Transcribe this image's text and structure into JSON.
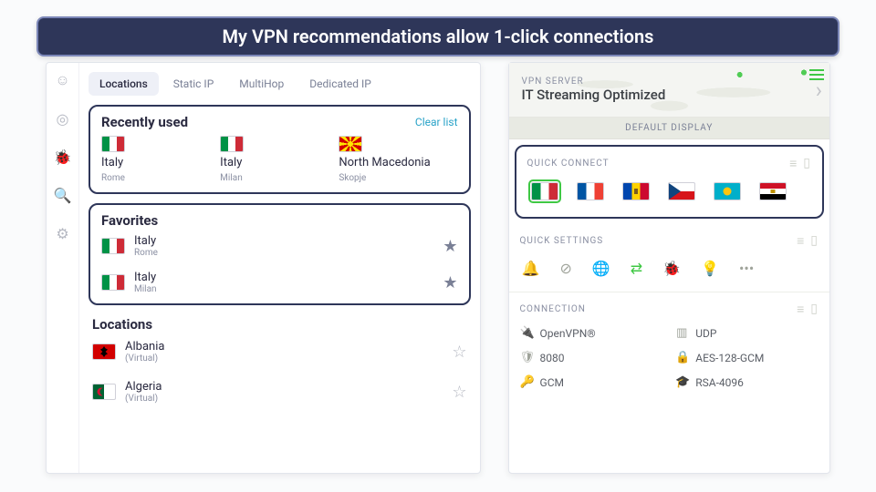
{
  "banner": {
    "text": "My VPN recommendations allow 1-click connections"
  },
  "left": {
    "rail_icons": [
      "user-icon",
      "radar-icon",
      "bug-icon",
      "search-icon",
      "gear-icon"
    ],
    "tabs": [
      {
        "id": "locations",
        "label": "Locations",
        "active": true
      },
      {
        "id": "static",
        "label": "Static IP",
        "active": false
      },
      {
        "id": "multihop",
        "label": "MultiHop",
        "active": false
      },
      {
        "id": "dedicated",
        "label": "Dedicated IP",
        "active": false
      }
    ],
    "recent": {
      "title": "Recently used",
      "clear": "Clear list",
      "items": [
        {
          "country": "Italy",
          "city": "Rome",
          "flag": "it"
        },
        {
          "country": "Italy",
          "city": "Milan",
          "flag": "it"
        },
        {
          "country": "North Macedonia",
          "city": "Skopje",
          "flag": "mk"
        }
      ]
    },
    "favorites": {
      "title": "Favorites",
      "items": [
        {
          "country": "Italy",
          "city": "Rome",
          "flag": "it"
        },
        {
          "country": "Italy",
          "city": "Milan",
          "flag": "it"
        }
      ]
    },
    "locations": {
      "title": "Locations",
      "items": [
        {
          "country": "Albania",
          "note": "(Virtual)",
          "flag": "al"
        },
        {
          "country": "Algeria",
          "note": "(Virtual)",
          "flag": "dz"
        }
      ]
    }
  },
  "right": {
    "kicker": "VPN SERVER",
    "server": "IT Streaming Optimized",
    "default_display": "DEFAULT DISPLAY",
    "quick_connect": {
      "title": "QUICK CONNECT",
      "flags": [
        {
          "code": "it",
          "selected": true
        },
        {
          "code": "fr",
          "selected": false
        },
        {
          "code": "md",
          "selected": false
        },
        {
          "code": "cz",
          "selected": false
        },
        {
          "code": "kz",
          "selected": false
        },
        {
          "code": "eg",
          "selected": false
        }
      ]
    },
    "quick_settings": {
      "title": "QUICK SETTINGS",
      "icons": [
        "bell",
        "shield-slash",
        "globe",
        "shuffle",
        "bug",
        "lightbulb",
        "more"
      ]
    },
    "connection": {
      "title": "CONNECTION",
      "items": [
        {
          "icon": "plug",
          "label": "OpenVPN®"
        },
        {
          "icon": "proto",
          "label": "UDP"
        },
        {
          "icon": "badge",
          "label": "8080"
        },
        {
          "icon": "lock",
          "label": "AES-128-GCM"
        },
        {
          "icon": "key",
          "label": "GCM"
        },
        {
          "icon": "cert",
          "label": "RSA-4096"
        }
      ]
    }
  }
}
